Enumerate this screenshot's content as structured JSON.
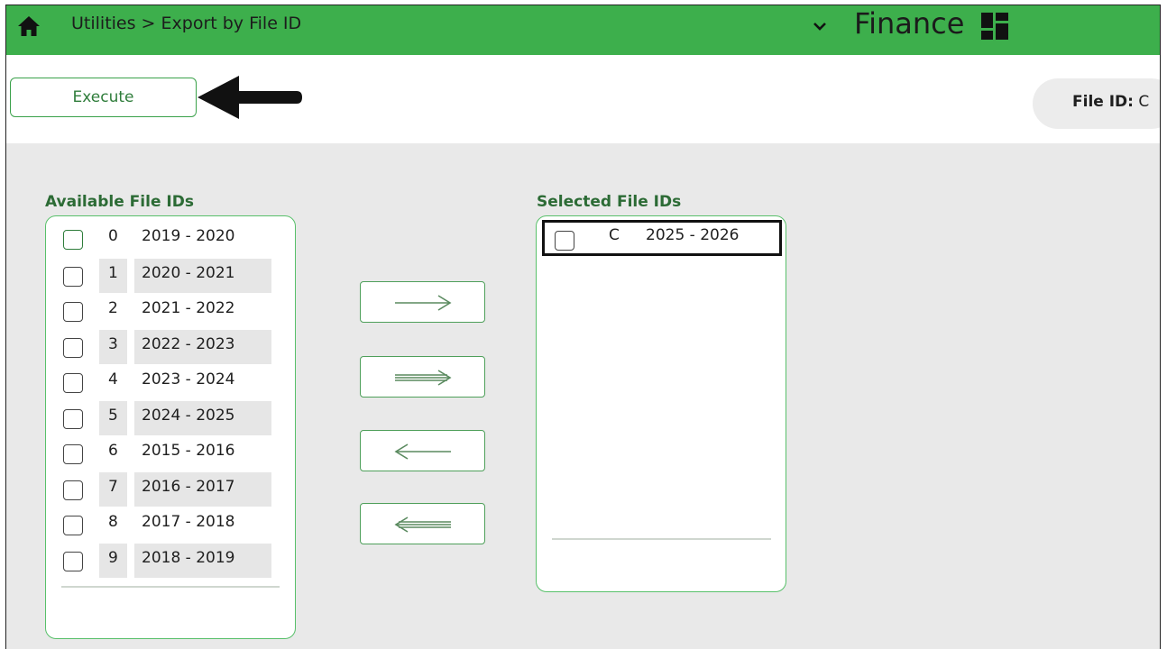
{
  "header": {
    "breadcrumb": "Utilities > Export by File ID",
    "app_title": "Finance",
    "icons": {
      "home": "home-icon",
      "dropdown": "chevron-down-icon",
      "apps": "dashboard-grid-icon"
    }
  },
  "toolbar": {
    "execute_label": "Execute",
    "file_id_label": "File ID:",
    "file_id_value": "C"
  },
  "available": {
    "title": "Available File IDs",
    "items": [
      {
        "id": "0",
        "years": "2019 - 2020"
      },
      {
        "id": "1",
        "years": "2020 - 2021"
      },
      {
        "id": "2",
        "years": "2021 - 2022"
      },
      {
        "id": "3",
        "years": "2022 - 2023"
      },
      {
        "id": "4",
        "years": "2023 - 2024"
      },
      {
        "id": "5",
        "years": "2024 - 2025"
      },
      {
        "id": "6",
        "years": "2015 - 2016"
      },
      {
        "id": "7",
        "years": "2016 - 2017"
      },
      {
        "id": "8",
        "years": "2017 - 2018"
      },
      {
        "id": "9",
        "years": "2018 - 2019"
      }
    ]
  },
  "selected": {
    "title": "Selected File IDs",
    "items": [
      {
        "id": "C",
        "years": "2025 - 2026"
      }
    ]
  },
  "move_buttons": [
    "move-right-icon",
    "move-all-right-icon",
    "move-left-icon",
    "move-all-left-icon"
  ],
  "colors": {
    "header_green": "#3daf4c",
    "accent_green": "#2f7d3b",
    "content_bg": "#e9e9e9"
  }
}
